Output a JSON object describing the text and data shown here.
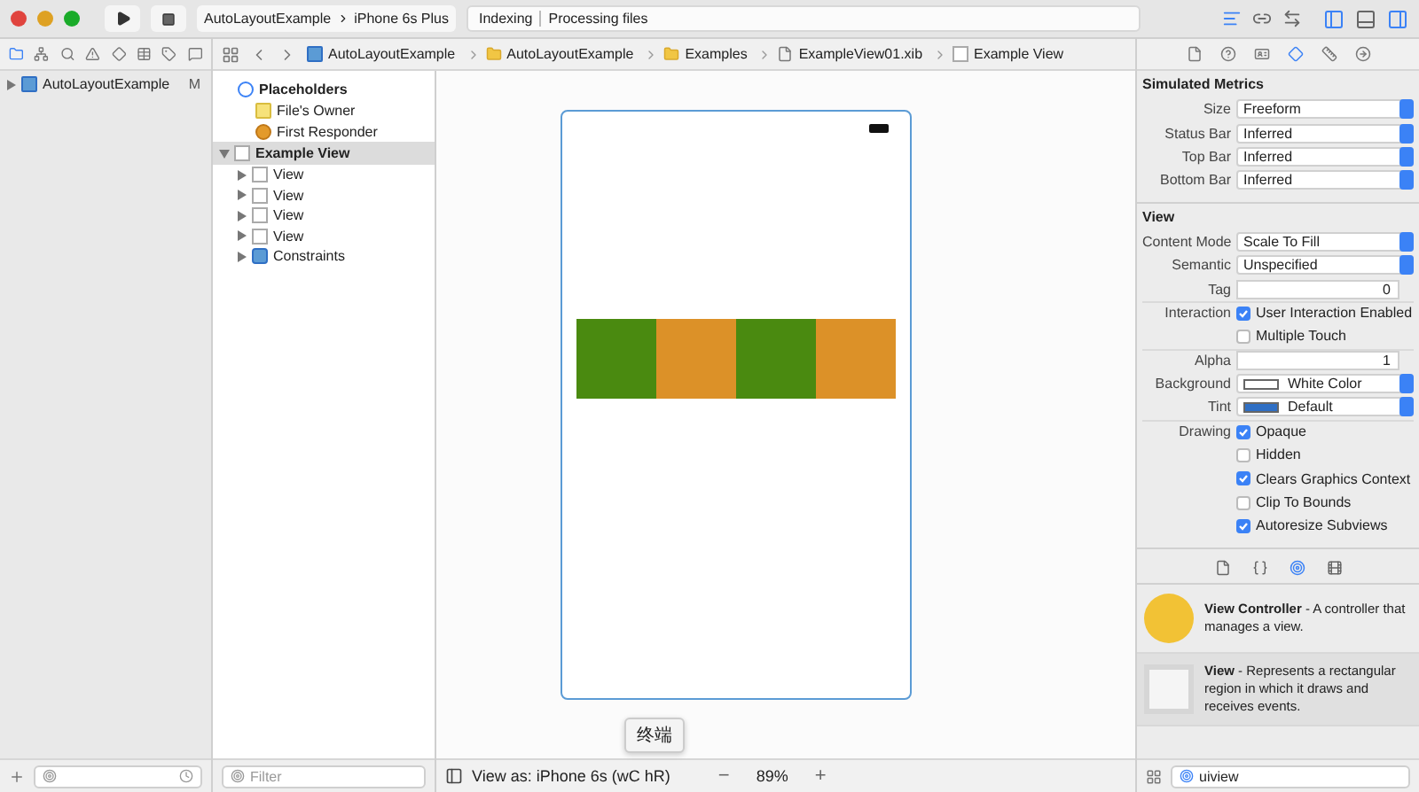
{
  "toolbar": {
    "scheme": "AutoLayoutExample",
    "device": "iPhone 6s Plus",
    "status": "Indexing",
    "activity": "Processing files"
  },
  "jump_bar": [
    "AutoLayoutExample",
    "AutoLayoutExample",
    "Examples",
    "ExampleView01.xib",
    "Example View"
  ],
  "navigator": {
    "items": [
      {
        "label": "AutoLayoutExample",
        "badge": "M",
        "expanded": false
      }
    ]
  },
  "outline": {
    "sections": [
      {
        "label": "Placeholders",
        "kind": "placeholder",
        "children": [
          {
            "label": "File's Owner",
            "kind": "owner"
          },
          {
            "label": "First Responder",
            "kind": "responder"
          }
        ]
      },
      {
        "label": "Example View",
        "kind": "view",
        "expanded": true,
        "selected": true,
        "children": [
          {
            "label": "View",
            "kind": "view",
            "expanded": false
          },
          {
            "label": "View",
            "kind": "view",
            "expanded": false
          },
          {
            "label": "View",
            "kind": "view",
            "expanded": false
          },
          {
            "label": "View",
            "kind": "view",
            "expanded": false
          },
          {
            "label": "Constraints",
            "kind": "constraints",
            "expanded": false
          }
        ]
      }
    ],
    "filter_placeholder": "Filter"
  },
  "canvas": {
    "stripe": [
      {
        "color": "#4a8a10"
      },
      {
        "color": "#dc9128"
      },
      {
        "color": "#4a8a10"
      },
      {
        "color": "#dc9128"
      }
    ],
    "view_as": "View as: iPhone 6s (wC hR)",
    "zoom": "89%",
    "zoom_out": "−",
    "zoom_in": "+",
    "tooltip": "终端"
  },
  "inspector": {
    "sections": [
      {
        "title": "Simulated Metrics",
        "rows": [
          {
            "kind": "select",
            "label": "Size",
            "value": "Freeform"
          },
          {
            "kind": "select",
            "label": "Status Bar",
            "value": "Inferred"
          },
          {
            "kind": "select",
            "label": "Top Bar",
            "value": "Inferred"
          },
          {
            "kind": "select",
            "label": "Bottom Bar",
            "value": "Inferred"
          }
        ]
      },
      {
        "title": "View",
        "rows": [
          {
            "kind": "select",
            "label": "Content Mode",
            "value": "Scale To Fill"
          },
          {
            "kind": "select",
            "label": "Semantic",
            "value": "Unspecified"
          },
          {
            "kind": "stepper",
            "label": "Tag",
            "value": "0"
          },
          {
            "kind": "check",
            "label": "Interaction",
            "text": "User Interaction Enabled",
            "checked": true,
            "rule": true
          },
          {
            "kind": "check",
            "text": "Multiple Touch",
            "checked": false
          },
          {
            "kind": "stepper",
            "label": "Alpha",
            "value": "1",
            "rule": true
          },
          {
            "kind": "color",
            "label": "Background",
            "value": "White Color",
            "color": "#ffffff"
          },
          {
            "kind": "color",
            "label": "Tint",
            "value": "Default",
            "color": "#2f6fc4"
          },
          {
            "kind": "check",
            "label": "Drawing",
            "text": "Opaque",
            "checked": true,
            "rule": true
          },
          {
            "kind": "check",
            "text": "Hidden",
            "checked": false
          },
          {
            "kind": "check",
            "text": "Clears Graphics Context",
            "checked": true
          },
          {
            "kind": "check",
            "text": "Clip To Bounds",
            "checked": false
          },
          {
            "kind": "check",
            "text": "Autoresize Subviews",
            "checked": true
          }
        ]
      }
    ]
  },
  "library": {
    "objects": [
      {
        "kind": "controller",
        "name": "View Controller",
        "description": " - A controller that manages a view.",
        "selected": false
      },
      {
        "kind": "view",
        "name": "View",
        "description": " - Represents a rectangular region in which it draws and receives events.",
        "selected": true
      }
    ],
    "search": "uiview"
  }
}
